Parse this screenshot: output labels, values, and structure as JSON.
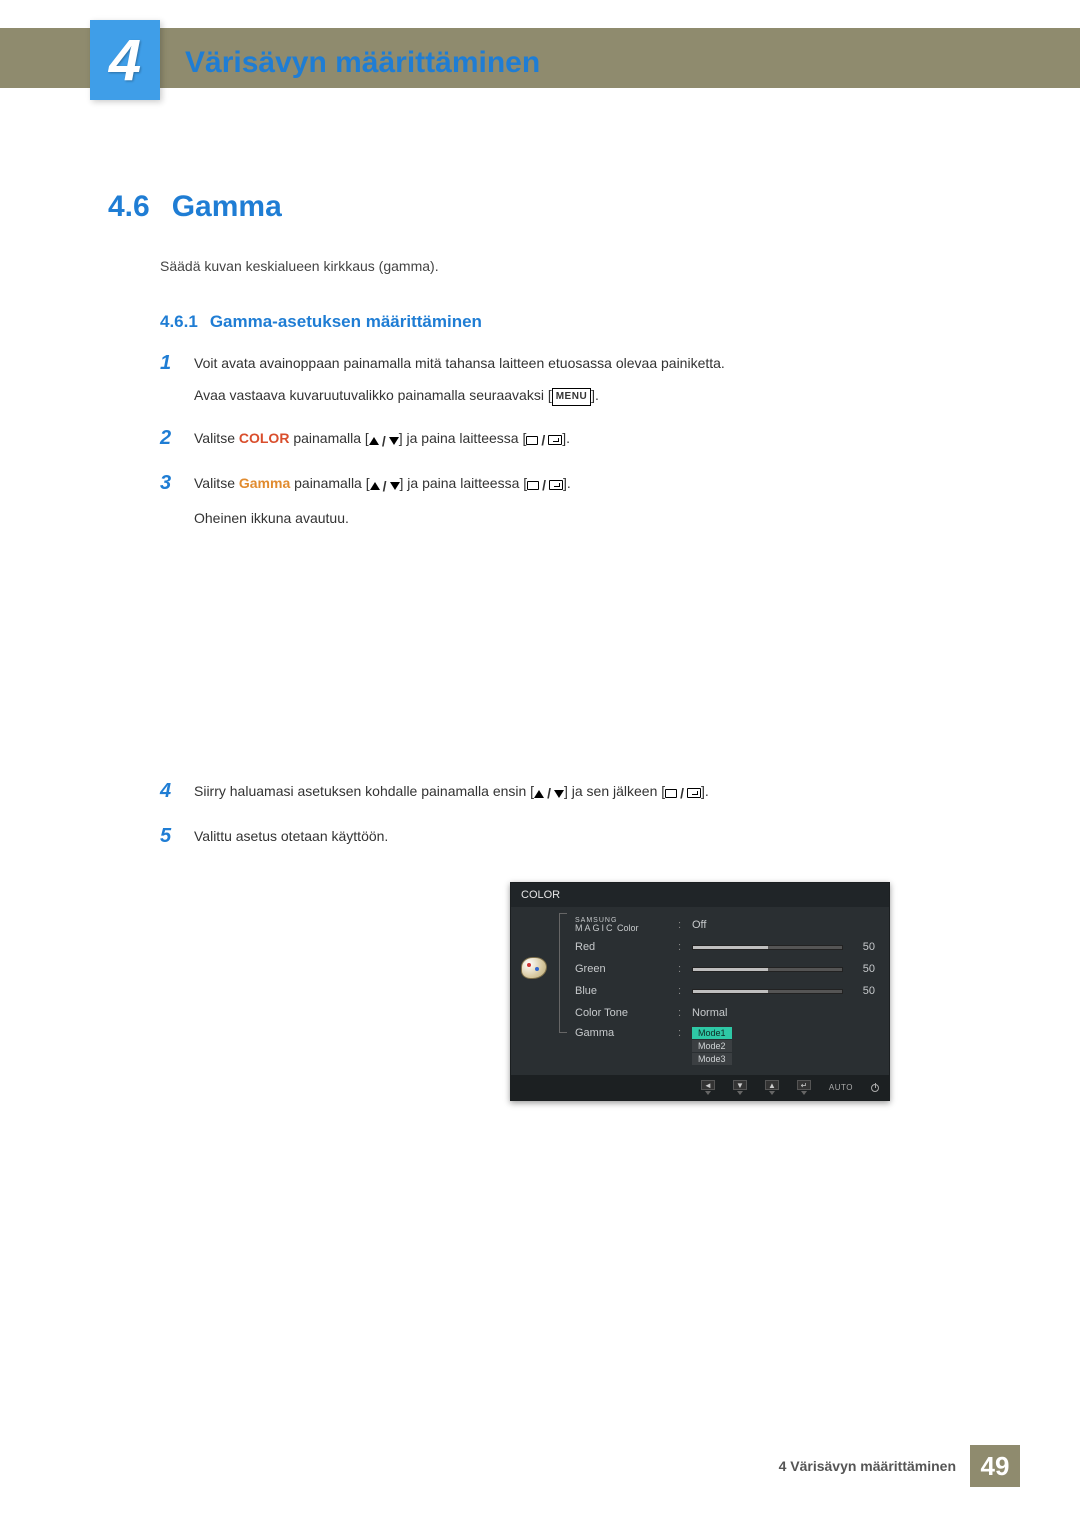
{
  "chapter": {
    "number": "4",
    "title": "Värisävyn määrittäminen"
  },
  "section": {
    "number": "4.6",
    "title": "Gamma",
    "description": "Säädä kuvan keskialueen kirkkaus (gamma)."
  },
  "subsection": {
    "number": "4.6.1",
    "title": "Gamma-asetuksen määrittäminen"
  },
  "steps": {
    "s1": {
      "n": "1",
      "l1": "Voit avata avainoppaan painamalla mitä tahansa laitteen etuosassa olevaa painiketta.",
      "l2a": "Avaa vastaava kuvaruutuvalikko painamalla seuraavaksi [",
      "l2b": "]."
    },
    "s2": {
      "n": "2",
      "a": "Valitse ",
      "color": "COLOR",
      "b": " painamalla [",
      "c": "] ja paina laitteessa [",
      "d": "]."
    },
    "s3": {
      "n": "3",
      "a": "Valitse ",
      "gamma": "Gamma",
      "b": " painamalla [",
      "c": "] ja paina laitteessa [",
      "d": "].",
      "e": "Oheinen ikkuna avautuu."
    },
    "s4": {
      "n": "4",
      "a": "Siirry haluamasi asetuksen kohdalle painamalla ensin [",
      "b": "] ja sen jälkeen [",
      "c": "]."
    },
    "s5": {
      "n": "5",
      "a": "Valittu asetus otetaan käyttöön."
    }
  },
  "menu_label": "MENU",
  "osd": {
    "title": "COLOR",
    "magic": {
      "samsung": "SAMSUNG",
      "magic": "MAGIC",
      "color": "Color"
    },
    "rows": {
      "magic_val": "Off",
      "red": {
        "label": "Red",
        "value": "50"
      },
      "green": {
        "label": "Green",
        "value": "50"
      },
      "blue": {
        "label": "Blue",
        "value": "50"
      },
      "tone": {
        "label": "Color Tone",
        "value": "Normal"
      },
      "gamma": {
        "label": "Gamma",
        "opts": [
          "Mode1",
          "Mode2",
          "Mode3"
        ]
      }
    },
    "footer_auto": "AUTO"
  },
  "footer": {
    "text": "4 Värisävyn määrittäminen",
    "page": "49"
  }
}
